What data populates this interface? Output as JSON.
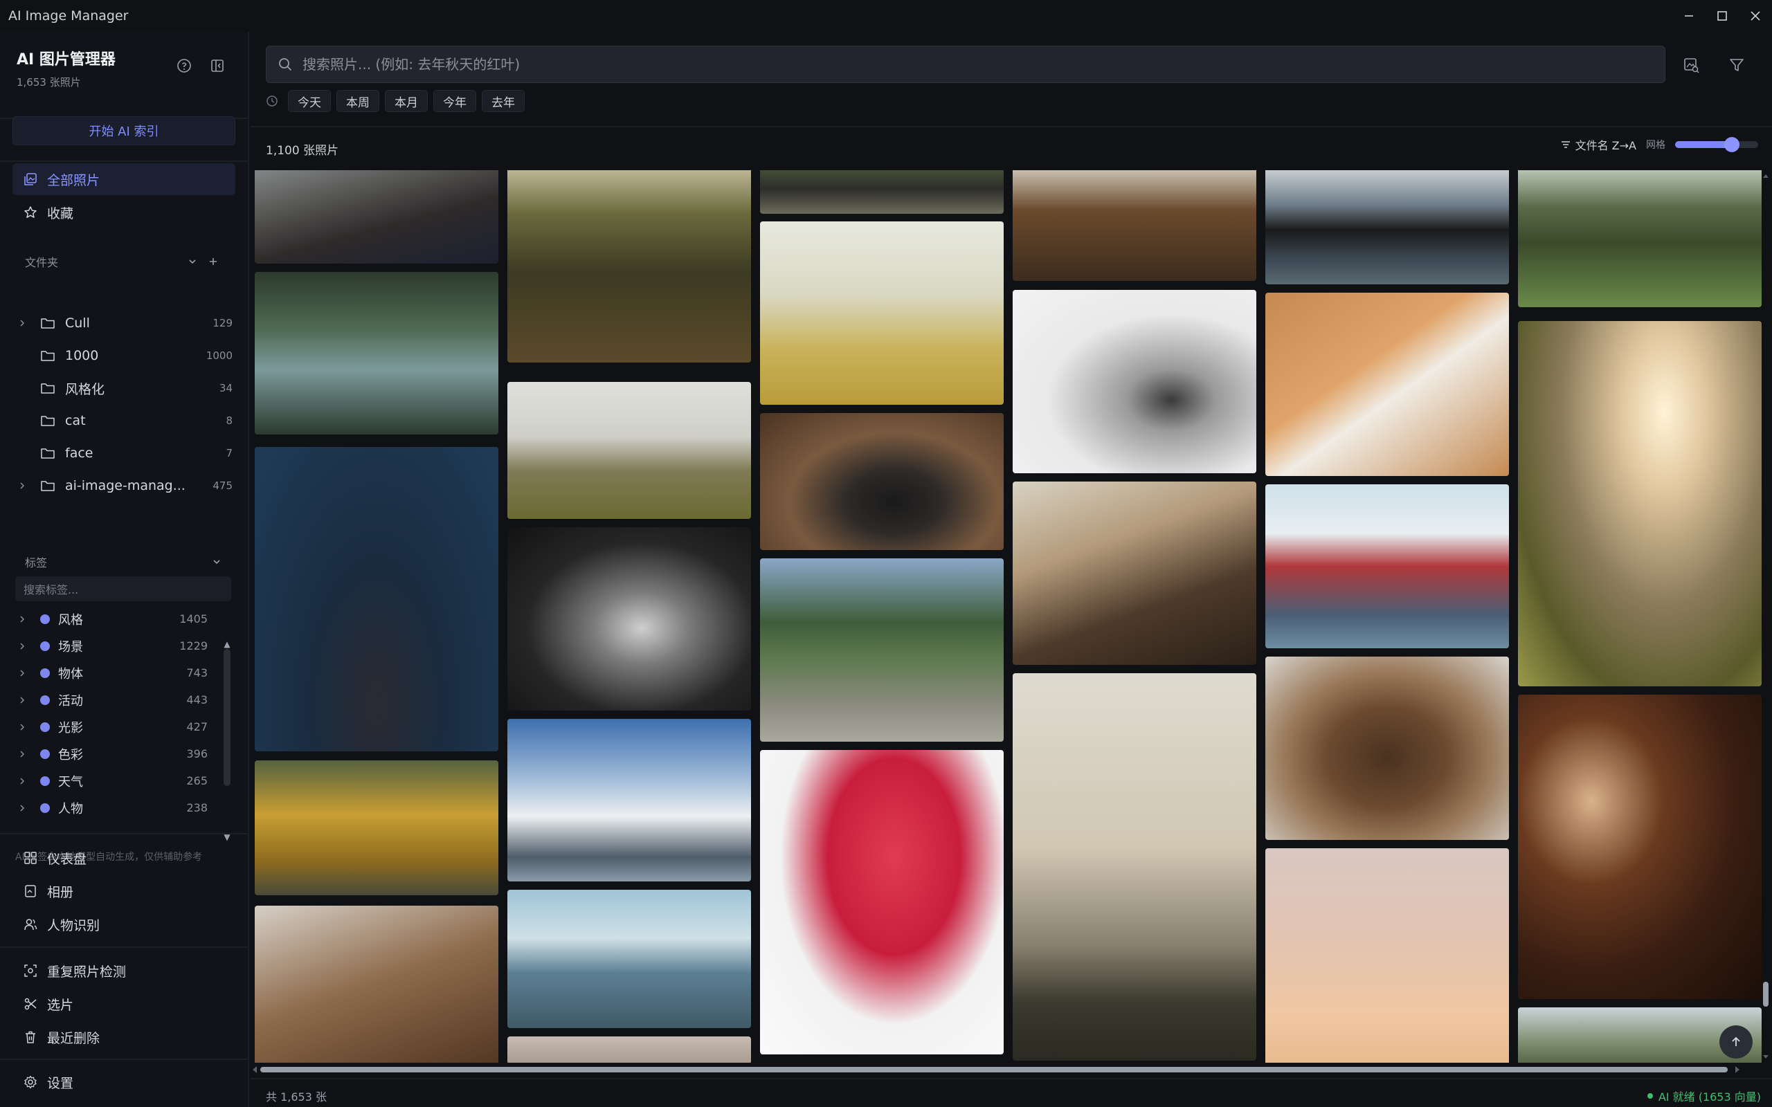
{
  "window": {
    "title": "AI Image Manager"
  },
  "sidebar": {
    "title": "AI 图片管理器",
    "subtitle": "1,653 张照片",
    "ai_index_button": "开始 AI 索引",
    "nav": {
      "all_photos": "全部照片",
      "favorites": "收藏"
    },
    "folders_label": "文件夹",
    "folders": [
      {
        "name": "Cull",
        "count": "129",
        "expandable": true
      },
      {
        "name": "1000",
        "count": "1000",
        "expandable": false
      },
      {
        "name": "风格化",
        "count": "34",
        "expandable": false
      },
      {
        "name": "cat",
        "count": "8",
        "expandable": false
      },
      {
        "name": "face",
        "count": "7",
        "expandable": false
      },
      {
        "name": "ai-image-manag...",
        "count": "475",
        "expandable": true
      }
    ],
    "tags_label": "标签",
    "tag_search_placeholder": "搜索标签...",
    "tags": [
      {
        "name": "风格",
        "count": "1405"
      },
      {
        "name": "场景",
        "count": "1229"
      },
      {
        "name": "物体",
        "count": "743"
      },
      {
        "name": "活动",
        "count": "443"
      },
      {
        "name": "光影",
        "count": "427"
      },
      {
        "name": "色彩",
        "count": "396"
      },
      {
        "name": "天气",
        "count": "265"
      },
      {
        "name": "人物",
        "count": "238"
      }
    ],
    "tag_note": "AI 标签由本地模型自动生成，仅供辅助参考",
    "tools": {
      "dashboard": "仪表盘",
      "albums": "相册",
      "people": "人物识别"
    },
    "utilities": {
      "duplicates": "重复照片检测",
      "culling": "选片",
      "recently_deleted": "最近删除"
    },
    "settings": "设置"
  },
  "main": {
    "search_placeholder": "搜索照片... (例如: 去年秋天的红叶)",
    "date_chips": [
      "今天",
      "本周",
      "本月",
      "今年",
      "去年"
    ],
    "photo_count": "1,100 张照片",
    "sort_label": "文件名 Z→A",
    "grid_label": "网格",
    "grid_size_fraction": 0.68,
    "status_left": "共 1,653 张",
    "status_right": "AI 就绪 (1653 向量)"
  },
  "colors": {
    "accent": "#7d86f7",
    "active_nav_bg": "#1c2033",
    "status_green": "#3dbf6e",
    "tag_dot": "#7e87f0"
  }
}
